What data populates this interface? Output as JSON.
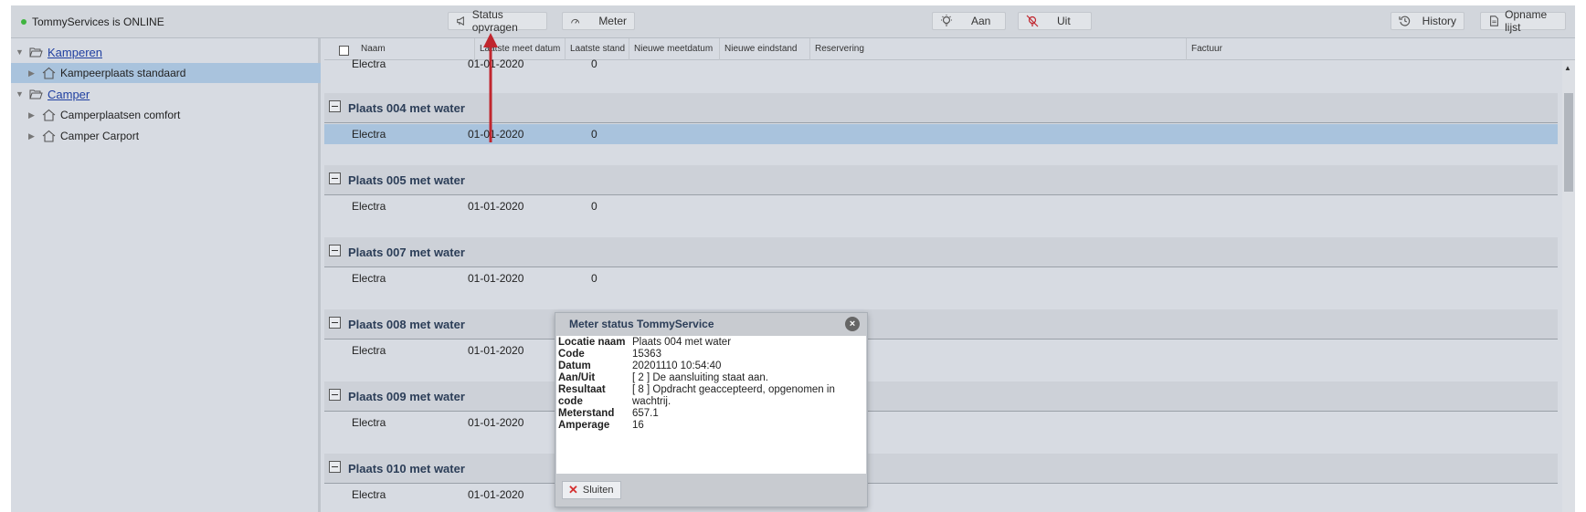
{
  "toolbar": {
    "status_text": "TommyServices is ONLINE",
    "status_color": "#3fb43f",
    "buttons": {
      "status": "Status opvragen",
      "meter": "Meter",
      "aan": "Aan",
      "uit": "Uit",
      "history": "History",
      "opname": "Opname lijst"
    }
  },
  "tree": {
    "kamperen": "Kamperen",
    "kampeerplaats": "Kampeerplaats standaard",
    "camper": "Camper",
    "comfort": "Camperplaatsen comfort",
    "carport": "Camper Carport"
  },
  "grid": {
    "columns": {
      "naam": "Naam",
      "laatste_meet": "Laatste meet datum",
      "laatste_stand": "Laatste stand",
      "nieuwe_meet": "Nieuwe meetdatum",
      "nieuwe_eind": "Nieuwe eindstand",
      "reservering": "Reservering",
      "factuur": "Factuur"
    },
    "top_row": {
      "naam": "Electra",
      "datum": "01-01-2020",
      "stand": "0"
    },
    "groups": [
      {
        "title": "Plaats 004 met water",
        "naam": "Electra",
        "datum": "01-01-2020",
        "stand": "0"
      },
      {
        "title": "Plaats 005 met water",
        "naam": "Electra",
        "datum": "01-01-2020",
        "stand": "0"
      },
      {
        "title": "Plaats 007 met water",
        "naam": "Electra",
        "datum": "01-01-2020",
        "stand": "0"
      },
      {
        "title": "Plaats 008 met water",
        "naam": "Electra",
        "datum": "01-01-2020",
        "stand": ""
      },
      {
        "title": "Plaats 009 met water",
        "naam": "Electra",
        "datum": "01-01-2020",
        "stand": ""
      },
      {
        "title": "Plaats 010 met water",
        "naam": "Electra",
        "datum": "01-01-2020",
        "stand": ""
      }
    ]
  },
  "modal": {
    "title": "Meter status TommyService",
    "fields": [
      {
        "key": "Locatie naam",
        "value": "Plaats 004 met water"
      },
      {
        "key": "Code",
        "value": "15363"
      },
      {
        "key": "Datum",
        "value": "20201110 10:54:40"
      },
      {
        "key": "Aan/Uit",
        "value": "[ 2 ] De aansluiting staat aan."
      },
      {
        "key": "Resultaat code",
        "value": "[ 8 ] Opdracht geaccepteerd, opgenomen in wachtrij."
      },
      {
        "key": "Meterstand",
        "value": "657.1"
      },
      {
        "key": "Amperage",
        "value": "16"
      }
    ],
    "close_label": "Sluiten"
  },
  "colors": {
    "accent_red": "#c0262e",
    "selection": "#a9c3dd"
  }
}
